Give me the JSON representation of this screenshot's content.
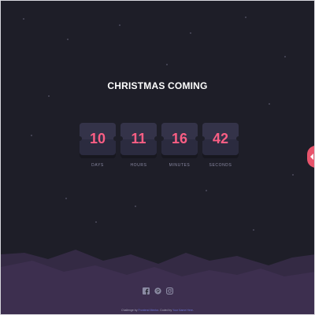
{
  "page": {
    "title": "CHRISTMAS COMING"
  },
  "countdown": [
    {
      "value": "10",
      "label": "DAYS"
    },
    {
      "value": "11",
      "label": "HOURS"
    },
    {
      "value": "16",
      "label": "MINUTES"
    },
    {
      "value": "42",
      "label": "SECONDS"
    }
  ],
  "socials": [
    {
      "icon": "facebook-icon"
    },
    {
      "icon": "pinterest-icon"
    },
    {
      "icon": "instagram-icon"
    }
  ],
  "attribution": {
    "prefix": "Challenge by",
    "challenge_link": "Frontend Mentor",
    "middle": ". Coded by",
    "author_link": "Your Name Here",
    "suffix": "."
  },
  "colors": {
    "background": "#1e1e28",
    "accent": "#fb5e84",
    "card": "#2b2b3f",
    "label": "#8b8aa3",
    "side_button": "#e8546c"
  }
}
